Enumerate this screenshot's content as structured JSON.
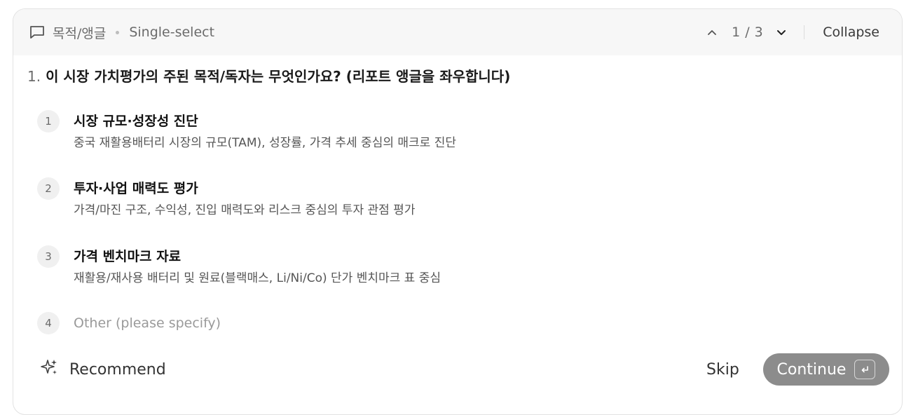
{
  "header": {
    "category": "목적/앵글",
    "mode": "Single-select",
    "pager": "1 / 3",
    "collapse_label": "Collapse"
  },
  "question": {
    "number": "1.",
    "text": "이 시장 가치평가의 주된 목적/독자는 무엇인가요? (리포트 앵글을 좌우합니다)"
  },
  "options": [
    {
      "index": "1",
      "title": "시장 규모·성장성 진단",
      "desc": "중국 재활용배터리 시장의 규모(TAM), 성장률, 가격 추세 중심의 매크로 진단"
    },
    {
      "index": "2",
      "title": "투자·사업 매력도 평가",
      "desc": "가격/마진 구조, 수익성, 진입 매력도와 리스크 중심의 투자 관점 평가"
    },
    {
      "index": "3",
      "title": "가격 벤치마크 자료",
      "desc": "재활용/재사용 배터리 및 원료(블랙매스, Li/Ni/Co) 단가 벤치마크 표 중심"
    },
    {
      "index": "4",
      "title": "Other (please specify)"
    }
  ],
  "footer": {
    "recommend_label": "Recommend",
    "skip_label": "Skip",
    "continue_label": "Continue"
  },
  "icons": {
    "header": "comment-icon",
    "prev": "chevron-up-icon",
    "next": "chevron-down-icon",
    "recommend": "sparkle-icon",
    "continue": "enter-key-icon"
  },
  "colors": {
    "header_bg": "#f7f7f7",
    "continue_bg": "#8c8c8c",
    "badge_bg": "#f0f0f0"
  }
}
